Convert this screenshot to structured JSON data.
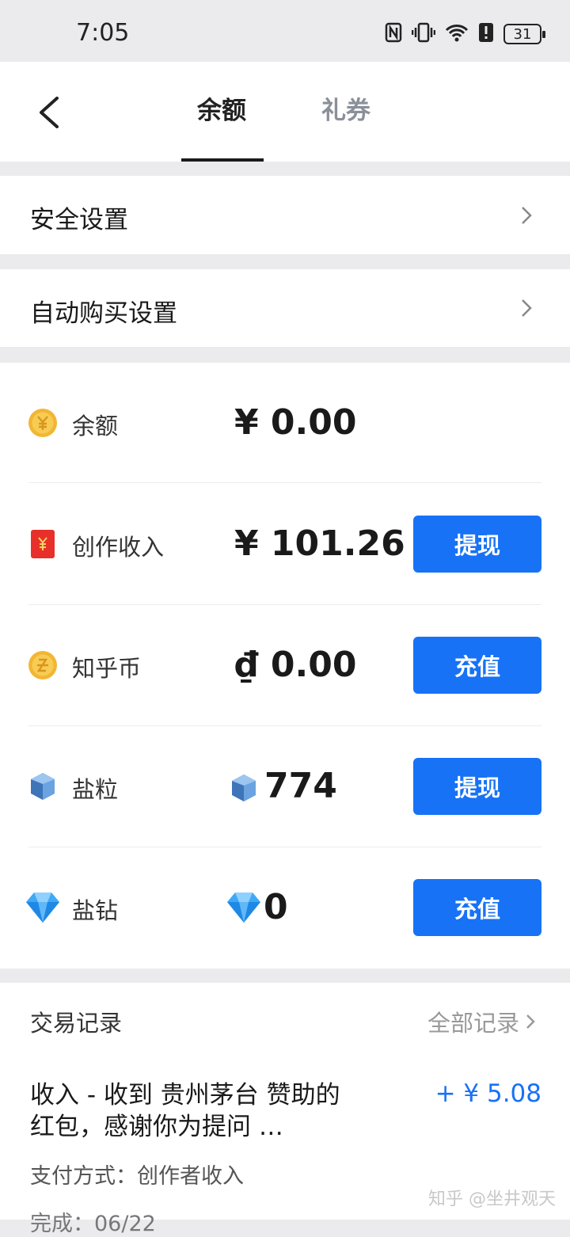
{
  "status_bar": {
    "time": "7:05",
    "battery": "31"
  },
  "nav": {
    "tabs": [
      {
        "label": "余额",
        "active": true
      },
      {
        "label": "礼券",
        "active": false
      }
    ]
  },
  "settings": [
    {
      "label": "安全设置"
    },
    {
      "label": "自动购买设置"
    }
  ],
  "wallet": {
    "rows": [
      {
        "label": "余额",
        "amount": "¥ 0.00",
        "icon": "yuan-coin-icon"
      },
      {
        "label": "创作收入",
        "amount": "¥ 101.26",
        "button": "提现",
        "icon": "red-envelope-icon"
      },
      {
        "label": "知乎币",
        "amount": "₫ 0.00",
        "button": "充值",
        "icon": "zhihu-coin-icon"
      },
      {
        "label": "盐粒",
        "amount": "774",
        "button": "提现",
        "icon": "salt-grain-icon"
      },
      {
        "label": "盐钻",
        "amount": "0",
        "button": "充值",
        "icon": "diamond-icon"
      }
    ]
  },
  "transactions": {
    "title": "交易记录",
    "view_all": "全部记录",
    "items": [
      {
        "description": "收入 - 收到 贵州茅台 赞助的红包，感谢你为提问 …",
        "amount": "+ ¥ 5.08",
        "payment_method": "支付方式：创作者收入",
        "completed": "完成：06/22"
      }
    ]
  },
  "watermark": "知乎 @坐井观天",
  "colors": {
    "accent": "#1772f6",
    "background": "#ebebed"
  }
}
